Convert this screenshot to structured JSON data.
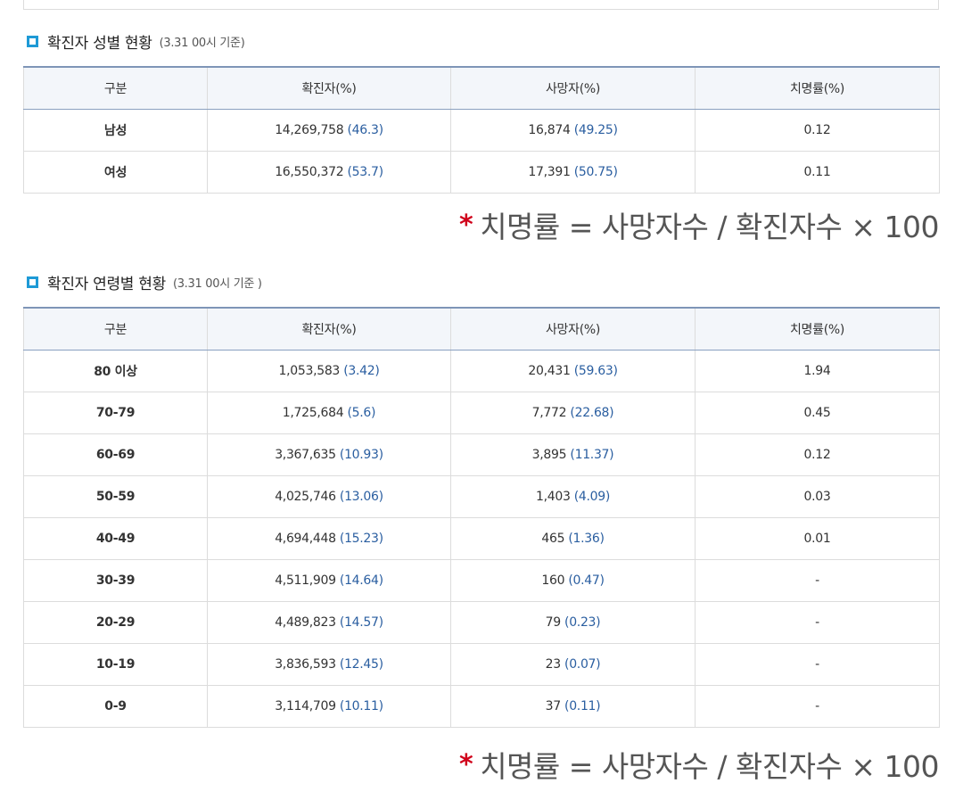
{
  "gender_section": {
    "title": "확진자 성별 현황",
    "subtitle": "(3.31 00시 기준)",
    "headers": [
      "구분",
      "확진자(%)",
      "사망자(%)",
      "치명률(%)"
    ],
    "rows": [
      {
        "label": "남성",
        "cases": "14,269,758",
        "cases_pct": "(46.3)",
        "deaths": "16,874",
        "deaths_pct": "(49.25)",
        "rate": "0.12"
      },
      {
        "label": "여성",
        "cases": "16,550,372",
        "cases_pct": "(53.7)",
        "deaths": "17,391",
        "deaths_pct": "(50.75)",
        "rate": "0.11"
      }
    ],
    "note_star": "*",
    "note": "치명률 = 사망자수 / 확진자수 × 100"
  },
  "age_section": {
    "title": "확진자 연령별 현황",
    "subtitle": "(3.31 00시 기준 )",
    "headers": [
      "구분",
      "확진자(%)",
      "사망자(%)",
      "치명률(%)"
    ],
    "rows": [
      {
        "label": "80 이상",
        "cases": "1,053,583",
        "cases_pct": "(3.42)",
        "deaths": "20,431",
        "deaths_pct": "(59.63)",
        "rate": "1.94"
      },
      {
        "label": "70-79",
        "cases": "1,725,684",
        "cases_pct": "(5.6)",
        "deaths": "7,772",
        "deaths_pct": "(22.68)",
        "rate": "0.45"
      },
      {
        "label": "60-69",
        "cases": "3,367,635",
        "cases_pct": "(10.93)",
        "deaths": "3,895",
        "deaths_pct": "(11.37)",
        "rate": "0.12"
      },
      {
        "label": "50-59",
        "cases": "4,025,746",
        "cases_pct": "(13.06)",
        "deaths": "1,403",
        "deaths_pct": "(4.09)",
        "rate": "0.03"
      },
      {
        "label": "40-49",
        "cases": "4,694,448",
        "cases_pct": "(15.23)",
        "deaths": "465",
        "deaths_pct": "(1.36)",
        "rate": "0.01"
      },
      {
        "label": "30-39",
        "cases": "4,511,909",
        "cases_pct": "(14.64)",
        "deaths": "160",
        "deaths_pct": "(0.47)",
        "rate": "-"
      },
      {
        "label": "20-29",
        "cases": "4,489,823",
        "cases_pct": "(14.57)",
        "deaths": "79",
        "deaths_pct": "(0.23)",
        "rate": "-"
      },
      {
        "label": "10-19",
        "cases": "3,836,593",
        "cases_pct": "(12.45)",
        "deaths": "23",
        "deaths_pct": "(0.07)",
        "rate": "-"
      },
      {
        "label": "0-9",
        "cases": "3,114,709",
        "cases_pct": "(10.11)",
        "deaths": "37",
        "deaths_pct": "(0.11)",
        "rate": "-"
      }
    ],
    "note_star": "*",
    "note": "치명률 = 사망자수 / 확진자수 × 100"
  },
  "colors": {
    "accent_icon": "#1e9ad6",
    "value_blue": "#2a5ea0",
    "header_bg": "#f3f6fa",
    "star_red": "#d0021b"
  }
}
